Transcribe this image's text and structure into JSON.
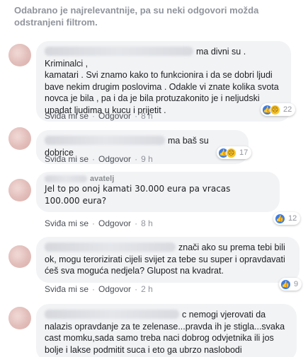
{
  "filter_note": "Odabrano je najrelevantnije, pa su neki odgovori možda odstranjeni filtrom.",
  "colors": {
    "like": "#3b7ce6",
    "sad": "#f7c52c",
    "bubble_bg": "#f2f3f5",
    "meta_text": "#90949c"
  },
  "comments": [
    {
      "author_fragment": "ma divni su .",
      "text": "Kriminalci ,\nkamatari . Svi znamo kako to funkcionira i da se dobri ljudi\nbave nekim drugim poslovima . Odakle vi znate kolika svota\nnovca je bila , pa i da je bila protuzakonito je i neljudski\nupadat ljudima u kucu i prijetit .",
      "like_label": "Sviđa mi se",
      "reply_label": "Odgovor",
      "time": "8 h",
      "reactions": {
        "icons": [
          "like-icon",
          "sad-icon"
        ],
        "count": "22"
      }
    },
    {
      "author_fragment": "",
      "text": "ma baš su dobrice",
      "like_label": "Sviđa mi se",
      "reply_label": "Odgovor",
      "time": "9 h",
      "reactions": {
        "icons": [
          "like-icon",
          "sad-icon"
        ],
        "count": "17"
      }
    },
    {
      "author_fragment": "avatelj",
      "text": "Jel to po onoj kamati 30.000 eura pa vracas\n100.000 eura?",
      "like_label": "Sviđa mi se",
      "reply_label": "Odgovor",
      "time": "8 h",
      "reactions": {
        "icons": [
          "like-icon"
        ],
        "count": "12"
      }
    },
    {
      "author_fragment": "znači ako su prema tebi bili",
      "text": "ok, mogu terorizirati cijeli svijet za tebe su super i opravdavati\nćeš sva moguća nedjela? Glupost na kvadrat.",
      "like_label": "Sviđa mi se",
      "reply_label": "Odgovor",
      "time": "2 h",
      "reactions": {
        "icons": [
          "like-icon"
        ],
        "count": "9"
      }
    },
    {
      "author_fragment": "c nemogi vjerovati da",
      "text": "nalazis opravdanje za te zelenase...pravda ih je stigla...svaka\ncast momku,sada samo treba naci dobrog odvjetnika ili jos\nbolje i lakse podmitit suca i eto ga ubrzo naslobodi",
      "like_label": "",
      "reply_label": "",
      "time": "",
      "reactions": {
        "icons": [],
        "count": ""
      }
    }
  ]
}
